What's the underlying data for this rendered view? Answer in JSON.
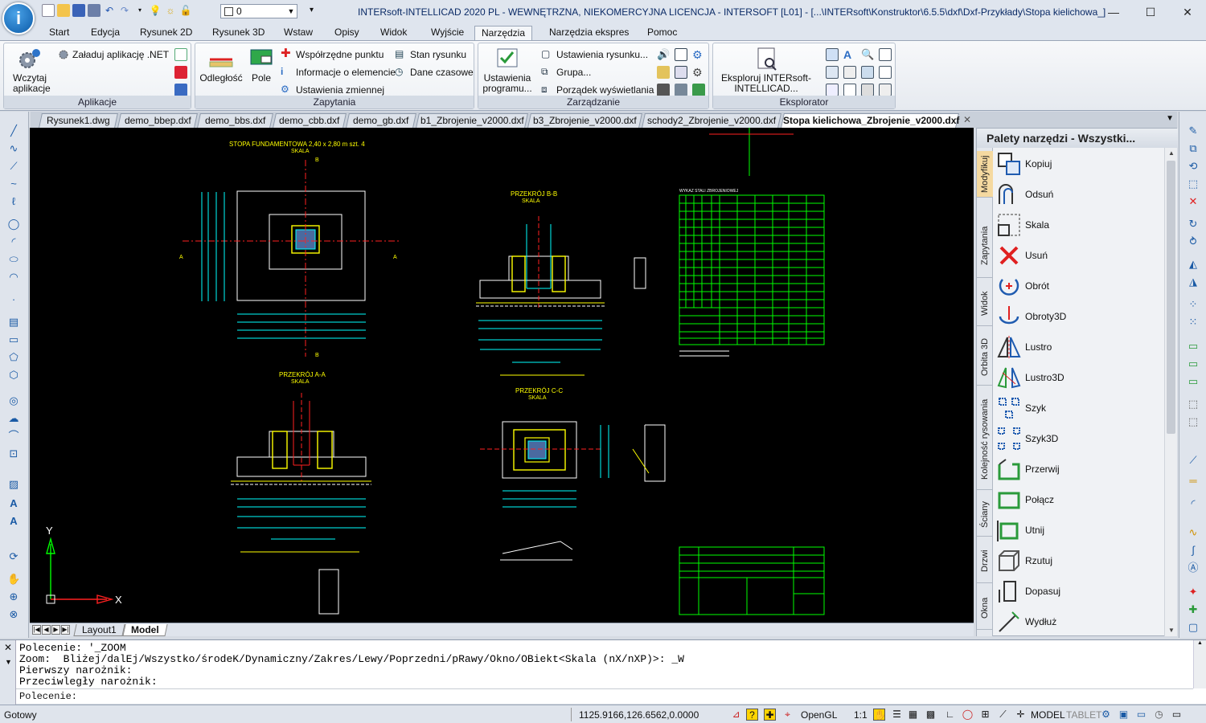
{
  "title_bar": {
    "logo_letter": "i",
    "layer_value": "0",
    "title": "INTERsoft-INTELLICAD 2020 PL - WEWNĘTRZNA, NIEKOMERCYJNA LICENCJA - INTERSOFT [L01] - [...\\INTERsoft\\Konstruktor\\6.5.5\\dxf\\Dxf-Przykłady\\Stopa kielichowa_]"
  },
  "menu_tabs": [
    "Start",
    "Edycja",
    "Rysunek 2D",
    "Rysunek 3D",
    "Wstaw",
    "Opisy",
    "Widok",
    "Wyjście",
    "Narzędzia",
    "Narzędzia ekspres",
    "Pomoc"
  ],
  "ribbon": {
    "aplikacje": {
      "label": "Aplikacje",
      "load_app": "Wczytaj aplikacje",
      "net_app": "Załaduj aplikację .NET"
    },
    "zapytania": {
      "label": "Zapytania",
      "distance": "Odległość",
      "field": "Pole",
      "point_coords": "Współrzędne punktu",
      "element_info": "Informacje o elemencie",
      "variable_settings": "Ustawienia zmiennej",
      "drawing_status": "Stan rysunku",
      "time_data": "Dane czasowe"
    },
    "zarzadzanie": {
      "label": "Zarządzanie",
      "program_settings": "Ustawienia programu...",
      "drawing_settings": "Ustawienia rysunku...",
      "group": "Grupa...",
      "display_order": "Porządek wyświetlania"
    },
    "eksplorator": {
      "label": "Eksplorator",
      "explore": "Eksploruj INTERsoft-INTELLICAD..."
    }
  },
  "doc_tabs": [
    "Rysunek1.dwg",
    "demo_bbep.dxf",
    "demo_bbs.dxf",
    "demo_cbb.dxf",
    "demo_gb.dxf",
    "b1_Zbrojenie_v2000.dxf",
    "b3_Zbrojenie_v2000.dxf",
    "schody2_Zbrojenie_v2000.dxf",
    "Stopa kielichowa_Zbrojenie_v2000.dxf"
  ],
  "drawing": {
    "title_main": "STOPA FUNDAMENTOWA 2,40 x 2,80 m szt. 4",
    "scale_label": "SKALA",
    "section_bb": "PRZEKRÓJ B-B",
    "section_aa": "PRZEKRÓJ A-A",
    "section_cc": "PRZEKRÓJ C-C",
    "table_title": "WYKAZ STALI ZBROJENIOWEJ",
    "ucs_y": "Y",
    "ucs_x": "X"
  },
  "layout_tabs": [
    "Layout1",
    "Model"
  ],
  "palette": {
    "title": "Palety narzędzi - Wszystki...",
    "vertical_tabs": [
      "Modyfikuj",
      "Zapytania",
      "Widok",
      "Orbita 3D",
      "Kolejność rysowania",
      "Ściany",
      "Drzwi",
      "Okna"
    ],
    "items": [
      "Kopiuj",
      "Odsuń",
      "Skala",
      "Usuń",
      "Obrót",
      "Obroty3D",
      "Lustro",
      "Lustro3D",
      "Szyk",
      "Szyk3D",
      "Przerwij",
      "Połącz",
      "Utnij",
      "Rzutuj",
      "Dopasuj",
      "Wydłuż"
    ]
  },
  "command": {
    "lines": [
      "Polecenie: '_ZOOM",
      "Zoom:  Bliżej/dalEj/Wszystko/środeK/Dynamiczny/Zakres/Lewy/Poprzedni/pRawy/Okno/OBiekt<Skala (nX/nXP)>: _W",
      "Pierwszy narożnik:",
      "Przeciwległy narożnik:"
    ],
    "prompt": "Polecenie:"
  },
  "status": {
    "text": "Gotowy",
    "coords": "1125.9166,126.6562,0.0000",
    "opengl": "OpenGL",
    "scale": "1:1",
    "model": "MODEL",
    "tablet": "TABLET"
  },
  "colors": {
    "accent": "#1a5aa5",
    "canvas": "#000000",
    "cad_cyan": "#00ffff",
    "cad_yellow": "#ffff00",
    "cad_red": "#ff2020",
    "cad_green": "#00ff00"
  }
}
